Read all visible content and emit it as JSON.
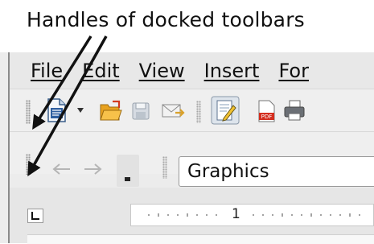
{
  "caption": "Handles of docked toolbars",
  "menu": [
    "File",
    "Edit",
    "View",
    "Insert",
    "For"
  ],
  "toolbar_standard": {
    "icons": [
      "new-document-icon",
      "dropdown-arrow-icon",
      "open-folder-icon",
      "save-icon",
      "email-icon",
      "edit-mode-icon",
      "export-pdf-icon",
      "print-icon"
    ]
  },
  "toolbar_formatting": {
    "icons": [
      "back-arrow-icon",
      "forward-arrow-icon",
      "toolbar-options-icon"
    ],
    "style_value": "Graphics"
  },
  "ruler": {
    "label": "1"
  }
}
